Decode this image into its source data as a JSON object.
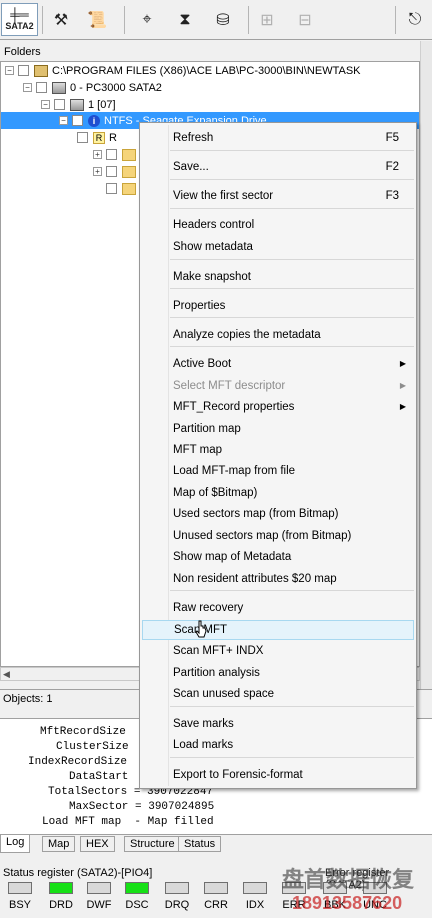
{
  "toolbar": {
    "sata_label": "SATA2",
    "icons": [
      "tools-icon",
      "scroll-icon",
      "binoculars-icon",
      "transfer-icon",
      "disk-read-icon",
      "disabled-tree-icon",
      "disabled-tree2-icon",
      "exit-icon"
    ]
  },
  "folders_header": "Folders",
  "tree": {
    "root": "C:\\PROGRAM FILES (X86)\\ACE LAB\\PC-3000\\BIN\\NEWTASK",
    "device": "0 - PC3000 SATA2",
    "partition_group": "1 [07]",
    "selected": "NTFS - Seagate Expansion Drive",
    "child_r": "R"
  },
  "objects_label": "Objects: 1",
  "log": {
    "lines": [
      "MftRecordSize",
      "ClusterSize",
      "IndexRecordSize",
      "DataStart",
      "TotalSectors = 3907022847",
      "MaxSector = 3907024895",
      "Load MFT map  - Map filled"
    ]
  },
  "tabs": [
    "Log",
    "Map",
    "HEX",
    "Structure",
    "Status"
  ],
  "status": {
    "title": "Status register (SATA2)-[PIO4]",
    "title_right": "Error register (SATA2)",
    "leds": [
      {
        "label": "BSY",
        "on": false
      },
      {
        "label": "DRD",
        "on": true
      },
      {
        "label": "DWF",
        "on": false
      },
      {
        "label": "DSC",
        "on": true
      },
      {
        "label": "DRQ",
        "on": false
      },
      {
        "label": "CRR",
        "on": false
      },
      {
        "label": "IDX",
        "on": false
      },
      {
        "label": "ERR",
        "on": false
      },
      {
        "label": "BBK",
        "on": false
      },
      {
        "label": "UNC",
        "on": false
      }
    ]
  },
  "menu": {
    "items": [
      {
        "label": "Refresh",
        "shortcut": "F5"
      },
      {
        "label": "Save...",
        "shortcut": "F2"
      },
      {
        "label": "View the first sector",
        "shortcut": "F3"
      },
      {
        "label": "Headers control"
      },
      {
        "label": "Show metadata"
      },
      {
        "label": "Make snapshot"
      },
      {
        "label": "Properties"
      },
      {
        "label": "Analyze copies the metadata"
      },
      {
        "label": "Active Boot",
        "submenu": true
      },
      {
        "label": "Select MFT descriptor",
        "submenu": true,
        "disabled": true
      },
      {
        "label": "MFT_Record properties",
        "submenu": true
      },
      {
        "label": "Partition map"
      },
      {
        "label": "MFT map"
      },
      {
        "label": "Load MFT-map from file"
      },
      {
        "label": "Map of $Bitmap)"
      },
      {
        "label": "Used sectors map (from Bitmap)"
      },
      {
        "label": "Unused sectors map (from Bitmap)"
      },
      {
        "label": "Show map of Metadata"
      },
      {
        "label": "Non resident attributes $20 map"
      },
      {
        "label": "Raw recovery"
      },
      {
        "label": "Scan MFT",
        "highlighted": true
      },
      {
        "label": "Scan MFT+ INDX"
      },
      {
        "label": "Partition analysis"
      },
      {
        "label": "Scan unused space"
      },
      {
        "label": "Save marks"
      },
      {
        "label": "Load marks"
      },
      {
        "label": "Export to Forensic-format"
      }
    ]
  },
  "watermark": {
    "line1": "盘首数据恢复",
    "line2": "18913587620"
  }
}
